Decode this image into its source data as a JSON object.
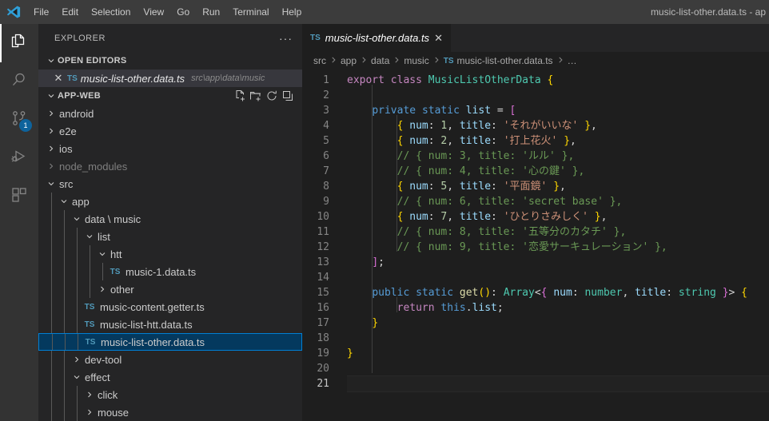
{
  "window": {
    "title": "music-list-other.data.ts - ap",
    "logo_icon": "vscode-logo-icon"
  },
  "menubar": {
    "items": [
      {
        "label": "File"
      },
      {
        "label": "Edit"
      },
      {
        "label": "Selection"
      },
      {
        "label": "View"
      },
      {
        "label": "Go"
      },
      {
        "label": "Run"
      },
      {
        "label": "Terminal"
      },
      {
        "label": "Help"
      }
    ]
  },
  "activitybar": {
    "items": [
      {
        "name": "explorer",
        "icon": "files-icon",
        "active": true,
        "badge": ""
      },
      {
        "name": "search",
        "icon": "search-icon",
        "active": false,
        "badge": ""
      },
      {
        "name": "source-control",
        "icon": "source-control-icon",
        "active": false,
        "badge": "1"
      },
      {
        "name": "run-and-debug",
        "icon": "run-debug-icon",
        "active": false,
        "badge": ""
      },
      {
        "name": "extensions",
        "icon": "extensions-icon",
        "active": false,
        "badge": ""
      }
    ]
  },
  "sidebar": {
    "title": "EXPLORER",
    "more_actions": "···",
    "open_editors": {
      "header": "OPEN EDITORS",
      "items": [
        {
          "name": "music-list-other.data.ts",
          "path": "src\\app\\data\\music",
          "badge": "TS",
          "close": "✕"
        }
      ]
    },
    "workspace": {
      "header": "APP-WEB",
      "actions": [
        "new-file-icon",
        "new-folder-icon",
        "refresh-icon",
        "collapse-all-icon"
      ],
      "tree": [
        {
          "label": "android",
          "depth": 1,
          "kind": "folder",
          "state": "collapsed",
          "dim": false,
          "selected": false
        },
        {
          "label": "e2e",
          "depth": 1,
          "kind": "folder",
          "state": "collapsed",
          "dim": false,
          "selected": false
        },
        {
          "label": "ios",
          "depth": 1,
          "kind": "folder",
          "state": "collapsed",
          "dim": false,
          "selected": false
        },
        {
          "label": "node_modules",
          "depth": 1,
          "kind": "folder",
          "state": "collapsed",
          "dim": true,
          "selected": false
        },
        {
          "label": "src",
          "depth": 1,
          "kind": "folder",
          "state": "expanded",
          "dim": false,
          "selected": false
        },
        {
          "label": "app",
          "depth": 2,
          "kind": "folder",
          "state": "expanded",
          "dim": false,
          "selected": false
        },
        {
          "label": "data \\ music",
          "depth": 3,
          "kind": "folder",
          "state": "expanded",
          "dim": false,
          "selected": false
        },
        {
          "label": "list",
          "depth": 4,
          "kind": "folder",
          "state": "expanded",
          "dim": false,
          "selected": false
        },
        {
          "label": "htt",
          "depth": 5,
          "kind": "folder",
          "state": "expanded",
          "dim": false,
          "selected": false
        },
        {
          "label": "music-1.data.ts",
          "depth": 6,
          "kind": "file",
          "state": "",
          "dim": false,
          "selected": false
        },
        {
          "label": "other",
          "depth": 5,
          "kind": "folder",
          "state": "collapsed",
          "dim": false,
          "selected": false
        },
        {
          "label": "music-content.getter.ts",
          "depth": 4,
          "kind": "file",
          "state": "",
          "dim": false,
          "selected": false
        },
        {
          "label": "music-list-htt.data.ts",
          "depth": 4,
          "kind": "file",
          "state": "",
          "dim": false,
          "selected": false
        },
        {
          "label": "music-list-other.data.ts",
          "depth": 4,
          "kind": "file",
          "state": "",
          "dim": false,
          "selected": true
        },
        {
          "label": "dev-tool",
          "depth": 3,
          "kind": "folder",
          "state": "collapsed",
          "dim": false,
          "selected": false
        },
        {
          "label": "effect",
          "depth": 3,
          "kind": "folder",
          "state": "expanded",
          "dim": false,
          "selected": false
        },
        {
          "label": "click",
          "depth": 4,
          "kind": "folder",
          "state": "collapsed",
          "dim": false,
          "selected": false
        },
        {
          "label": "mouse",
          "depth": 4,
          "kind": "folder",
          "state": "collapsed",
          "dim": false,
          "selected": false
        }
      ]
    }
  },
  "editor": {
    "tabs": [
      {
        "badge": "TS",
        "label": "music-list-other.data.ts",
        "close": "✕",
        "active": true,
        "italic": true
      }
    ],
    "breadcrumb": [
      {
        "label": "src",
        "badge": ""
      },
      {
        "label": "app",
        "badge": ""
      },
      {
        "label": "data",
        "badge": ""
      },
      {
        "label": "music",
        "badge": ""
      },
      {
        "label": "music-list-other.data.ts",
        "badge": "TS"
      },
      {
        "label": "…",
        "badge": ""
      }
    ],
    "active_line": 21,
    "line_numbers": [
      1,
      2,
      3,
      4,
      5,
      6,
      7,
      8,
      9,
      10,
      11,
      12,
      13,
      14,
      15,
      16,
      17,
      18,
      19,
      20,
      21
    ],
    "lines": [
      {
        "n": 1,
        "tokens": [
          {
            "t": "export",
            "c": "t-kw"
          },
          {
            "t": " ",
            "c": "t-punc"
          },
          {
            "t": "class",
            "c": "t-kw"
          },
          {
            "t": " ",
            "c": "t-punc"
          },
          {
            "t": "MusicListOtherData",
            "c": "t-type"
          },
          {
            "t": " ",
            "c": "t-punc"
          },
          {
            "t": "{",
            "c": "t-brc1"
          }
        ]
      },
      {
        "n": 2,
        "tokens": []
      },
      {
        "n": 3,
        "tokens": [
          {
            "t": "    ",
            "c": "t-punc"
          },
          {
            "t": "private",
            "c": "t-kw2"
          },
          {
            "t": " ",
            "c": "t-punc"
          },
          {
            "t": "static",
            "c": "t-kw2"
          },
          {
            "t": " ",
            "c": "t-punc"
          },
          {
            "t": "list",
            "c": "t-var"
          },
          {
            "t": " = ",
            "c": "t-punc"
          },
          {
            "t": "[",
            "c": "t-brc2"
          }
        ]
      },
      {
        "n": 4,
        "tokens": [
          {
            "t": "        ",
            "c": "t-punc"
          },
          {
            "t": "{",
            "c": "t-brc1"
          },
          {
            "t": " ",
            "c": "t-punc"
          },
          {
            "t": "num",
            "c": "t-var"
          },
          {
            "t": ": ",
            "c": "t-punc"
          },
          {
            "t": "1",
            "c": "t-num"
          },
          {
            "t": ", ",
            "c": "t-punc"
          },
          {
            "t": "title",
            "c": "t-var"
          },
          {
            "t": ": ",
            "c": "t-punc"
          },
          {
            "t": "'それがいいな'",
            "c": "t-str"
          },
          {
            "t": " ",
            "c": "t-punc"
          },
          {
            "t": "}",
            "c": "t-brc1"
          },
          {
            "t": ",",
            "c": "t-punc"
          }
        ]
      },
      {
        "n": 5,
        "tokens": [
          {
            "t": "        ",
            "c": "t-punc"
          },
          {
            "t": "{",
            "c": "t-brc1"
          },
          {
            "t": " ",
            "c": "t-punc"
          },
          {
            "t": "num",
            "c": "t-var"
          },
          {
            "t": ": ",
            "c": "t-punc"
          },
          {
            "t": "2",
            "c": "t-num"
          },
          {
            "t": ", ",
            "c": "t-punc"
          },
          {
            "t": "title",
            "c": "t-var"
          },
          {
            "t": ": ",
            "c": "t-punc"
          },
          {
            "t": "'打上花火'",
            "c": "t-str"
          },
          {
            "t": " ",
            "c": "t-punc"
          },
          {
            "t": "}",
            "c": "t-brc1"
          },
          {
            "t": ",",
            "c": "t-punc"
          }
        ]
      },
      {
        "n": 6,
        "tokens": [
          {
            "t": "        // { num: 3, title: 'ルル' },",
            "c": "t-com"
          }
        ]
      },
      {
        "n": 7,
        "tokens": [
          {
            "t": "        // { num: 4, title: '心の鍵' },",
            "c": "t-com"
          }
        ]
      },
      {
        "n": 8,
        "tokens": [
          {
            "t": "        ",
            "c": "t-punc"
          },
          {
            "t": "{",
            "c": "t-brc1"
          },
          {
            "t": " ",
            "c": "t-punc"
          },
          {
            "t": "num",
            "c": "t-var"
          },
          {
            "t": ": ",
            "c": "t-punc"
          },
          {
            "t": "5",
            "c": "t-num"
          },
          {
            "t": ", ",
            "c": "t-punc"
          },
          {
            "t": "title",
            "c": "t-var"
          },
          {
            "t": ": ",
            "c": "t-punc"
          },
          {
            "t": "'平面鏡'",
            "c": "t-str"
          },
          {
            "t": " ",
            "c": "t-punc"
          },
          {
            "t": "}",
            "c": "t-brc1"
          },
          {
            "t": ",",
            "c": "t-punc"
          }
        ]
      },
      {
        "n": 9,
        "tokens": [
          {
            "t": "        // { num: 6, title: 'secret base' },",
            "c": "t-com"
          }
        ]
      },
      {
        "n": 10,
        "tokens": [
          {
            "t": "        ",
            "c": "t-punc"
          },
          {
            "t": "{",
            "c": "t-brc1"
          },
          {
            "t": " ",
            "c": "t-punc"
          },
          {
            "t": "num",
            "c": "t-var"
          },
          {
            "t": ": ",
            "c": "t-punc"
          },
          {
            "t": "7",
            "c": "t-num"
          },
          {
            "t": ", ",
            "c": "t-punc"
          },
          {
            "t": "title",
            "c": "t-var"
          },
          {
            "t": ": ",
            "c": "t-punc"
          },
          {
            "t": "'ひとりさみしく'",
            "c": "t-str"
          },
          {
            "t": " ",
            "c": "t-punc"
          },
          {
            "t": "}",
            "c": "t-brc1"
          },
          {
            "t": ",",
            "c": "t-punc"
          }
        ]
      },
      {
        "n": 11,
        "tokens": [
          {
            "t": "        // { num: 8, title: '五等分のカタチ' },",
            "c": "t-com"
          }
        ]
      },
      {
        "n": 12,
        "tokens": [
          {
            "t": "        // { num: 9, title: '恋愛サーキュレーション' },",
            "c": "t-com"
          }
        ]
      },
      {
        "n": 13,
        "tokens": [
          {
            "t": "    ",
            "c": "t-punc"
          },
          {
            "t": "]",
            "c": "t-brc2"
          },
          {
            "t": ";",
            "c": "t-punc"
          }
        ]
      },
      {
        "n": 14,
        "tokens": []
      },
      {
        "n": 15,
        "tokens": [
          {
            "t": "    ",
            "c": "t-punc"
          },
          {
            "t": "public",
            "c": "t-kw2"
          },
          {
            "t": " ",
            "c": "t-punc"
          },
          {
            "t": "static",
            "c": "t-kw2"
          },
          {
            "t": " ",
            "c": "t-punc"
          },
          {
            "t": "get",
            "c": "t-fn"
          },
          {
            "t": "()",
            "c": "t-brc1"
          },
          {
            "t": ": ",
            "c": "t-punc"
          },
          {
            "t": "Array",
            "c": "t-type"
          },
          {
            "t": "<",
            "c": "t-punc"
          },
          {
            "t": "{",
            "c": "t-brc2"
          },
          {
            "t": " ",
            "c": "t-punc"
          },
          {
            "t": "num",
            "c": "t-var"
          },
          {
            "t": ": ",
            "c": "t-punc"
          },
          {
            "t": "number",
            "c": "t-type"
          },
          {
            "t": ", ",
            "c": "t-punc"
          },
          {
            "t": "title",
            "c": "t-var"
          },
          {
            "t": ": ",
            "c": "t-punc"
          },
          {
            "t": "string",
            "c": "t-type"
          },
          {
            "t": " ",
            "c": "t-punc"
          },
          {
            "t": "}",
            "c": "t-brc2"
          },
          {
            "t": ">",
            "c": "t-punc"
          },
          {
            "t": " ",
            "c": "t-punc"
          },
          {
            "t": "{",
            "c": "t-brc1"
          }
        ]
      },
      {
        "n": 16,
        "tokens": [
          {
            "t": "        ",
            "c": "t-punc"
          },
          {
            "t": "return",
            "c": "t-kw"
          },
          {
            "t": " ",
            "c": "t-punc"
          },
          {
            "t": "this",
            "c": "t-kw2"
          },
          {
            "t": ".",
            "c": "t-punc"
          },
          {
            "t": "list",
            "c": "t-var"
          },
          {
            "t": ";",
            "c": "t-punc"
          }
        ]
      },
      {
        "n": 17,
        "tokens": [
          {
            "t": "    ",
            "c": "t-punc"
          },
          {
            "t": "}",
            "c": "t-brc1"
          }
        ]
      },
      {
        "n": 18,
        "tokens": []
      },
      {
        "n": 19,
        "tokens": [
          {
            "t": "}",
            "c": "t-brc1"
          }
        ]
      },
      {
        "n": 20,
        "tokens": []
      },
      {
        "n": 21,
        "tokens": []
      }
    ]
  },
  "colors": {
    "titlebar_bg": "#3c3c3c",
    "activitybar_bg": "#333333",
    "sidebar_bg": "#252526",
    "editor_bg": "#1e1e1e",
    "accent_blue": "#007fd4",
    "selection_bg": "#04395e",
    "badge_bg": "#0e639c"
  }
}
